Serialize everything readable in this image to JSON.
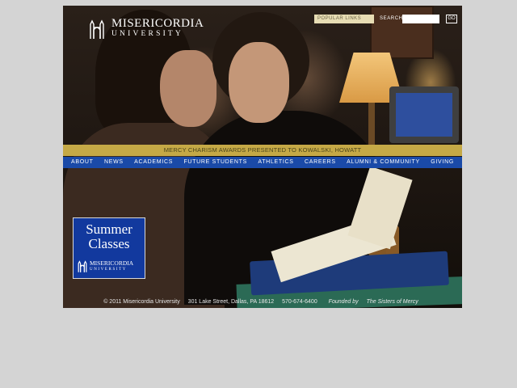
{
  "logo": {
    "line1": "MISERICORDIA",
    "line2": "UNIVERSITY"
  },
  "header": {
    "popular_links_label": "POPULAR LINKS",
    "search_label": "SEARCH",
    "search_value": "",
    "go_label": "GO"
  },
  "news": {
    "headline": "MERCY CHARISM AWARDS PRESENTED TO KOWALSKI, HOWATT"
  },
  "nav": {
    "items": [
      {
        "label": "ABOUT"
      },
      {
        "label": "NEWS"
      },
      {
        "label": "ACADEMICS"
      },
      {
        "label": "FUTURE STUDENTS"
      },
      {
        "label": "ATHLETICS"
      },
      {
        "label": "CAREERS"
      },
      {
        "label": "ALUMNI & COMMUNITY"
      },
      {
        "label": "GIVING"
      }
    ]
  },
  "badge": {
    "title_line1": "Summer",
    "title_line2": "Classes",
    "name_line1": "MISERICORDIA",
    "name_line2": "UNIVERSITY"
  },
  "footer": {
    "copyright": "© 2011 Misericordia University",
    "address": "301 Lake Street, Dallas, PA 18612",
    "phone": "570-674-6400",
    "founded_prefix": "Founded by",
    "founded_by": "The Sisters of Mercy"
  },
  "colors": {
    "page_background": "#d4d4d4",
    "news_bar": "#c5a946",
    "nav_bar": "#1a4aa8",
    "badge": "#12399e"
  },
  "icons": {
    "logo_mark": "university-building-icon"
  }
}
